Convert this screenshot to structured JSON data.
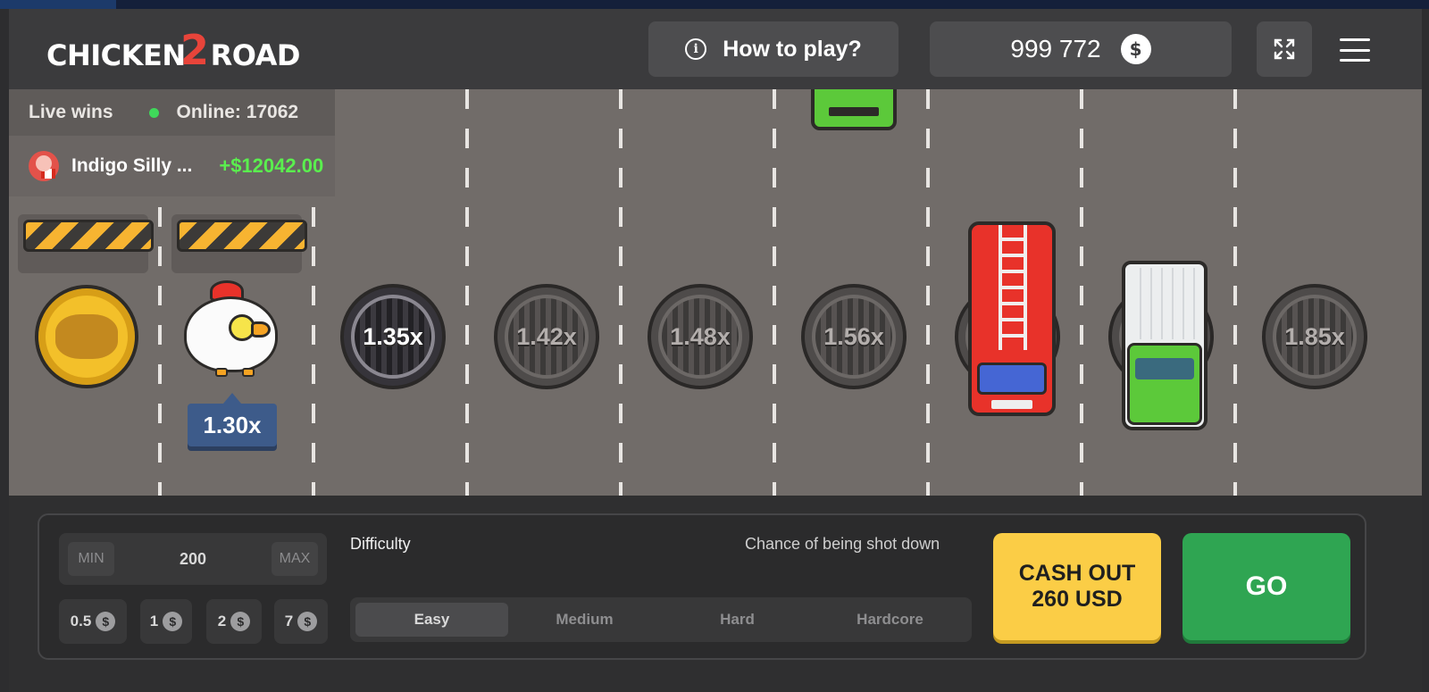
{
  "header": {
    "logo_text": "CHICKEN",
    "logo_number": "2",
    "logo_text2": "ROAD",
    "how_to_play": "How to play?",
    "balance": "999 772",
    "currency_symbol": "$"
  },
  "live": {
    "live_wins_label": "Live wins",
    "online_label": "Online: 17062",
    "winner_name": "Indigo Silly ...",
    "winner_amount": "+$12042.00"
  },
  "road": {
    "chicken_multiplier": "1.30x",
    "multipliers": [
      "1.35x",
      "1.42x",
      "1.48x",
      "1.56x",
      "1.85x"
    ]
  },
  "controls": {
    "min_label": "MIN",
    "bet_amount": "200",
    "max_label": "MAX",
    "chips": [
      "0.5",
      "1",
      "2",
      "7"
    ],
    "chip_symbol": "$",
    "difficulty_label": "Difficulty",
    "chance_label": "Chance of being shot down",
    "difficulty_options": [
      "Easy",
      "Medium",
      "Hard",
      "Hardcore"
    ],
    "selected_difficulty": "Easy",
    "cashout_line1": "CASH OUT",
    "cashout_line2": "260 USD",
    "go_label": "GO"
  },
  "colors": {
    "road": "#716c69",
    "cashout": "#fbcd46",
    "go": "#2fa552",
    "win_amount": "#5aef4e",
    "multiplier_tag": "#3d5b8a"
  }
}
